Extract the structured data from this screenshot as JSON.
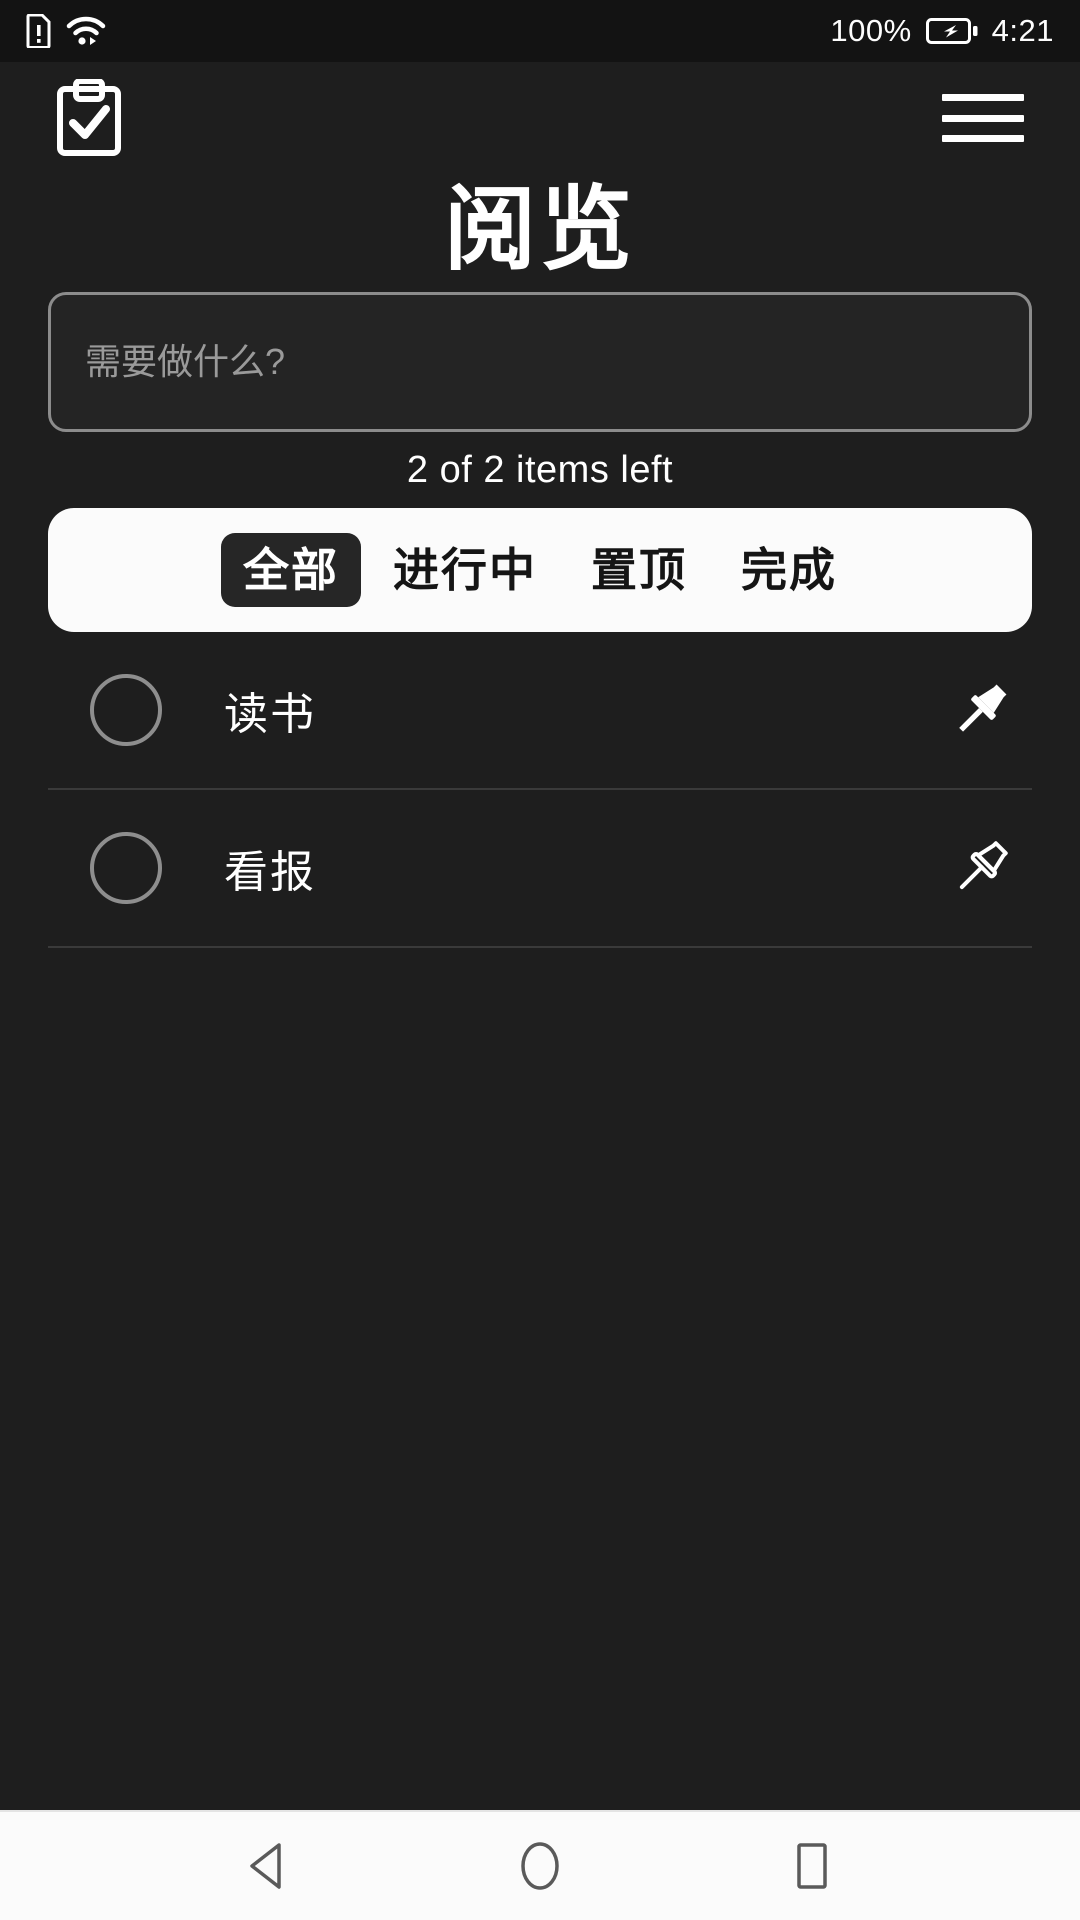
{
  "status_bar": {
    "sim_icon": "sim-alert-icon",
    "wifi_icon": "wifi-icon",
    "battery_percent": "100%",
    "battery_icon": "battery-charging-icon",
    "time": "4:21"
  },
  "app_bar": {
    "logo_icon": "clipboard-check-icon",
    "menu_icon": "hamburger-menu-icon"
  },
  "header": {
    "title": "阅览"
  },
  "new_todo": {
    "placeholder": "需要做什么?",
    "value": ""
  },
  "summary": {
    "items_left": "2 of 2 items left"
  },
  "filters": {
    "tabs": [
      {
        "label": "全部",
        "active": true
      },
      {
        "label": "进行中",
        "active": false
      },
      {
        "label": "置顶",
        "active": false
      },
      {
        "label": "完成",
        "active": false
      }
    ]
  },
  "todos": [
    {
      "label": "读书",
      "completed": false,
      "pinned": true,
      "checkbox_icon": "circle-unchecked-icon",
      "pin_icon": "pin-filled-icon"
    },
    {
      "label": "看报",
      "completed": false,
      "pinned": false,
      "checkbox_icon": "circle-unchecked-icon",
      "pin_icon": "pin-outline-icon"
    }
  ],
  "nav_bar": {
    "back": "back-triangle-icon",
    "home": "home-circle-icon",
    "recents": "recents-square-icon"
  },
  "colors": {
    "background": "#1e1e1e",
    "status_bar": "#131313",
    "card": "#fbfbfb",
    "accent_dark": "#262626",
    "text": "#ffffff",
    "muted": "#9a9a9a",
    "divider": "#3a3a3a"
  }
}
